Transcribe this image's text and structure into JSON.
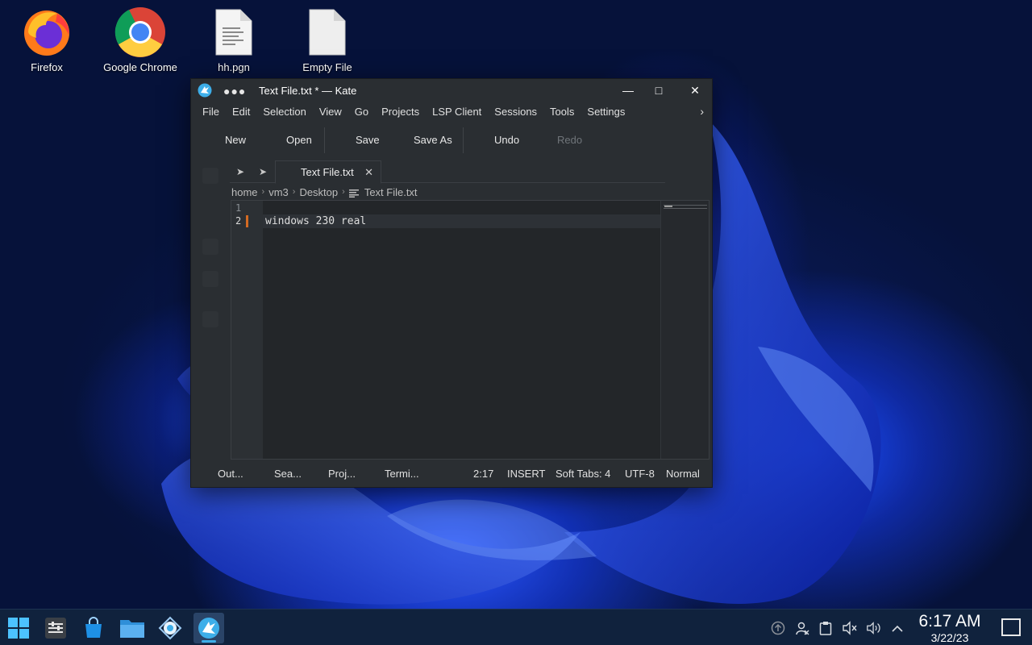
{
  "desktop": {
    "icons": [
      {
        "label": "Firefox",
        "icon": "firefox-icon"
      },
      {
        "label": "Google Chrome",
        "icon": "chrome-icon"
      },
      {
        "label": "hh.pgn",
        "icon": "text-document-icon"
      },
      {
        "label": "Empty File",
        "icon": "blank-document-icon"
      }
    ]
  },
  "window": {
    "dots": "●●●",
    "title": "Text File.txt * — Kate",
    "buttons": {
      "minimize": "—",
      "maximize": "□",
      "close": "✕"
    }
  },
  "menu": [
    "File",
    "Edit",
    "Selection",
    "View",
    "Go",
    "Projects",
    "LSP Client",
    "Sessions",
    "Tools",
    "Settings"
  ],
  "menu_more": "›",
  "toolbar": {
    "new": "New",
    "open": "Open",
    "save": "Save",
    "save_as": "Save As",
    "undo": "Undo",
    "redo": "Redo"
  },
  "tab": {
    "label": "Text File.txt",
    "close": "✕"
  },
  "breadcrumb": [
    "home",
    "vm3",
    "Desktop",
    "Text File.txt"
  ],
  "editor": {
    "line_numbers": [
      "1",
      "2"
    ],
    "lines": [
      "",
      "windows 230 real"
    ]
  },
  "status": {
    "output": "Out...",
    "search": "Sea...",
    "projects": "Proj...",
    "terminal": "Termi...",
    "cursor": "2:17",
    "mode": "INSERT",
    "indent": "Soft Tabs: 4",
    "encoding": "UTF-8",
    "input_mode": "Normal"
  },
  "clock": {
    "time": "6:17 AM",
    "date": "3/22/23"
  },
  "colors": {
    "accent": "#3daee9",
    "modified_marker": "#d46a22",
    "window_bg": "#2a2e32"
  }
}
